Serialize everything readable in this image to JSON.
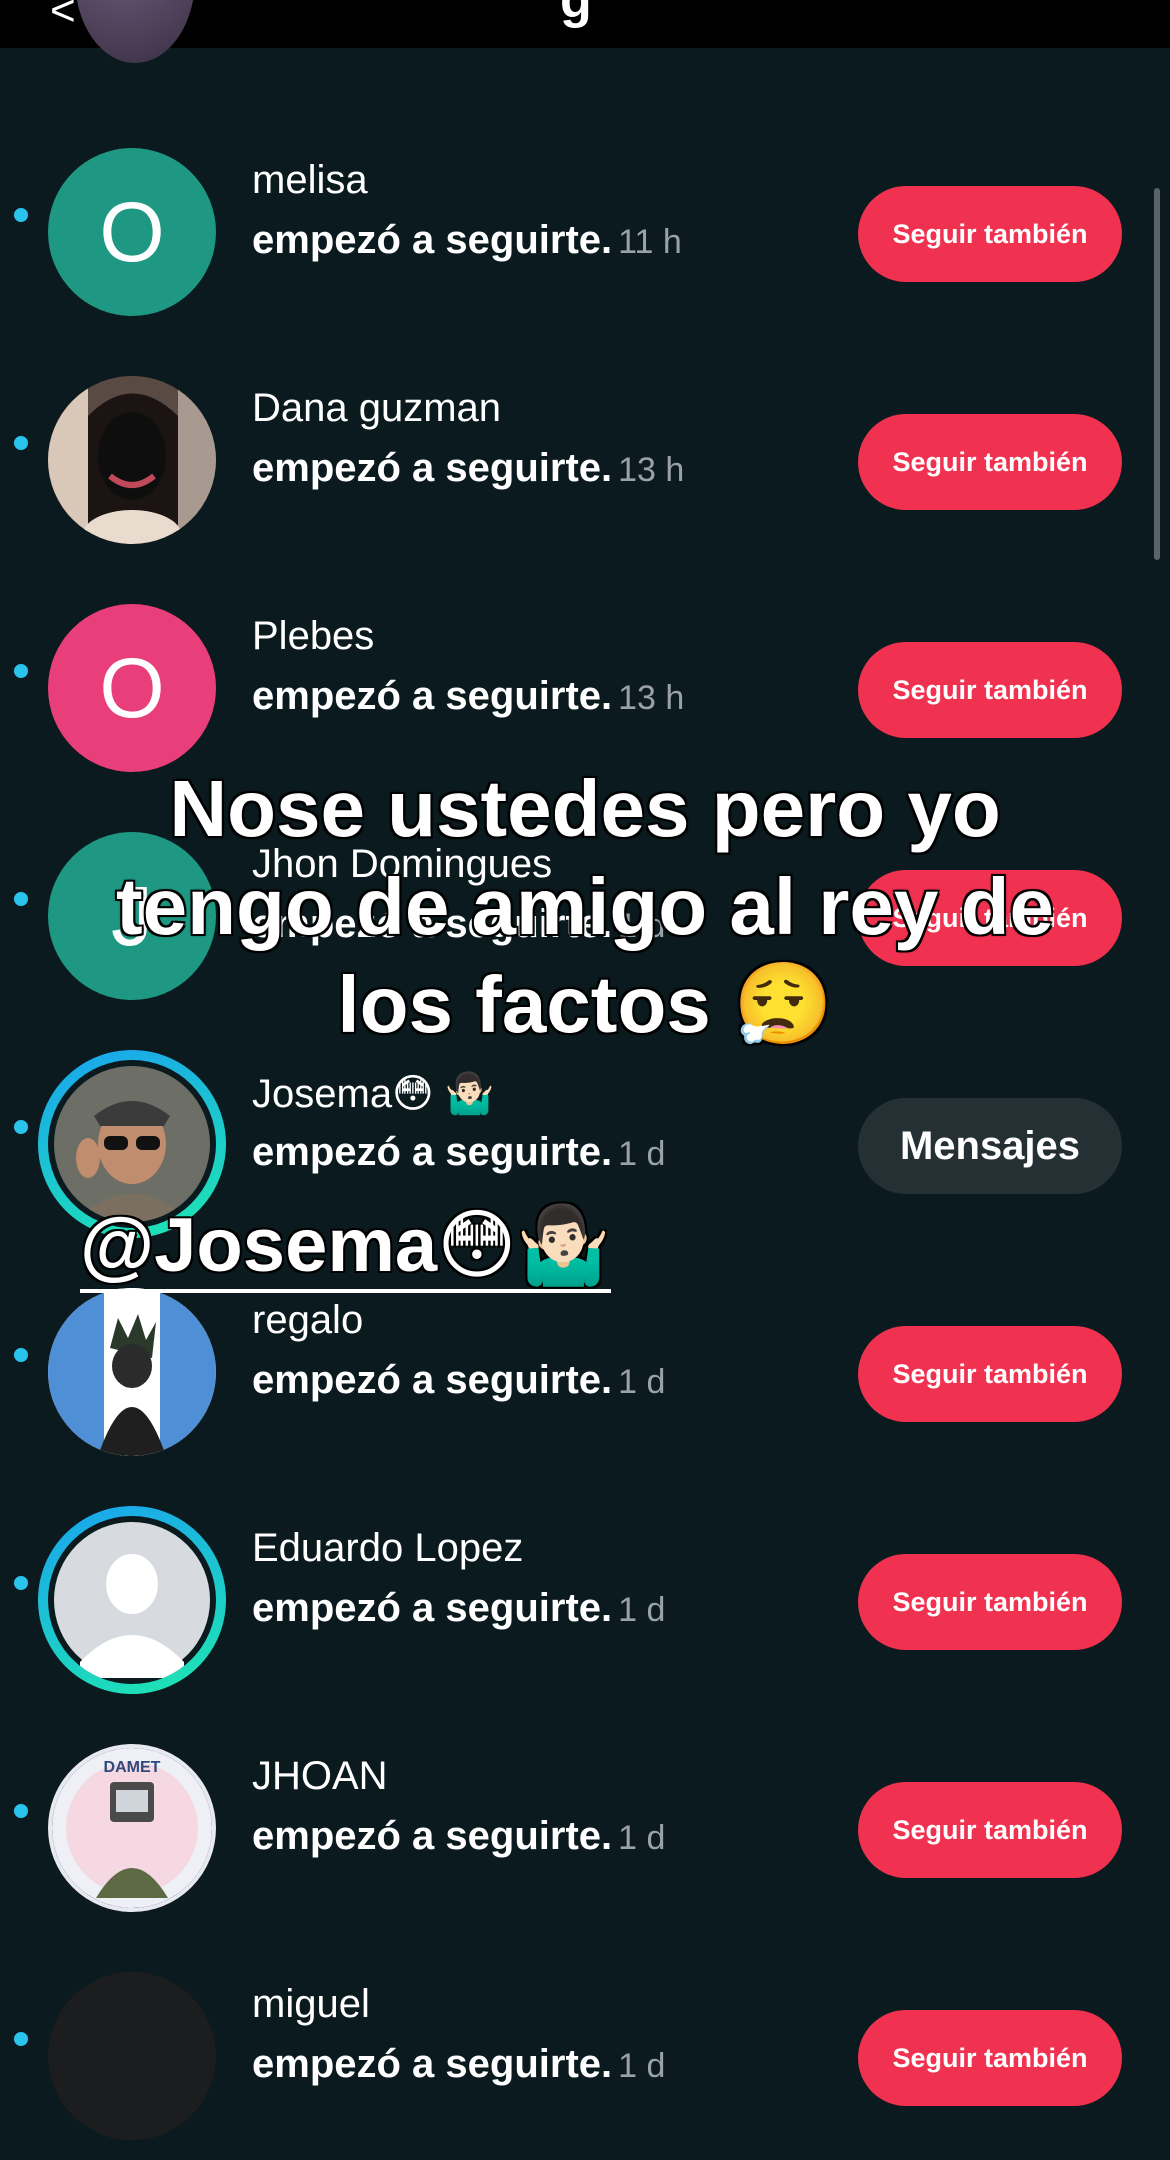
{
  "header": {
    "back_glyph": "<",
    "title_fragment": "g"
  },
  "rows": [
    {
      "name": "melisa",
      "action": "empezó a seguirte.",
      "time": "11 h",
      "button": "Seguir también",
      "avatar_letter": "O",
      "avatar_color": "#1e9882"
    },
    {
      "name": "Dana guzman",
      "action": "empezó a seguirte.",
      "time": "13 h",
      "button": "Seguir también"
    },
    {
      "name": "Plebes",
      "action": "empezó a seguirte.",
      "time": "13 h",
      "button": "Seguir también",
      "avatar_letter": "O",
      "avatar_color": "#e83e7a"
    },
    {
      "name": "Jhon Domingues",
      "action": "empezó a seguirte.",
      "time": "1 d",
      "button": "Seguir también",
      "avatar_letter": "J",
      "avatar_color": "#1e9882"
    },
    {
      "name": "Josema😳 🤷🏻‍♂️",
      "action": "empezó a seguirte.",
      "time": "1 d",
      "button": "Mensajes"
    },
    {
      "name": "regalo",
      "action": "empezó a seguirte.",
      "time": "1 d",
      "button": "Seguir también"
    },
    {
      "name": "Eduardo Lopez",
      "action": "empezó a seguirte.",
      "time": "1 d",
      "button": "Seguir también"
    },
    {
      "name": "JHOAN",
      "action": "empezó a seguirte.",
      "time": "1 d",
      "button": "Seguir también",
      "avatar_text": "DAMET"
    },
    {
      "name": "miguel",
      "action": "empezó a seguirte.",
      "time": "1 d",
      "button": "Seguir también"
    }
  ],
  "overlay": {
    "caption": "Nose ustedes pero yo tengo de amigo al rey de los factos 😮‍💨",
    "mention": "@Josema😳🤷🏻‍♂️"
  },
  "colors": {
    "accent": "#f0314f",
    "unread_dot": "#29c3ec",
    "background": "#0b1a1e",
    "story_ring_start": "#1aa3f0",
    "story_ring_end": "#1ee8b0"
  }
}
